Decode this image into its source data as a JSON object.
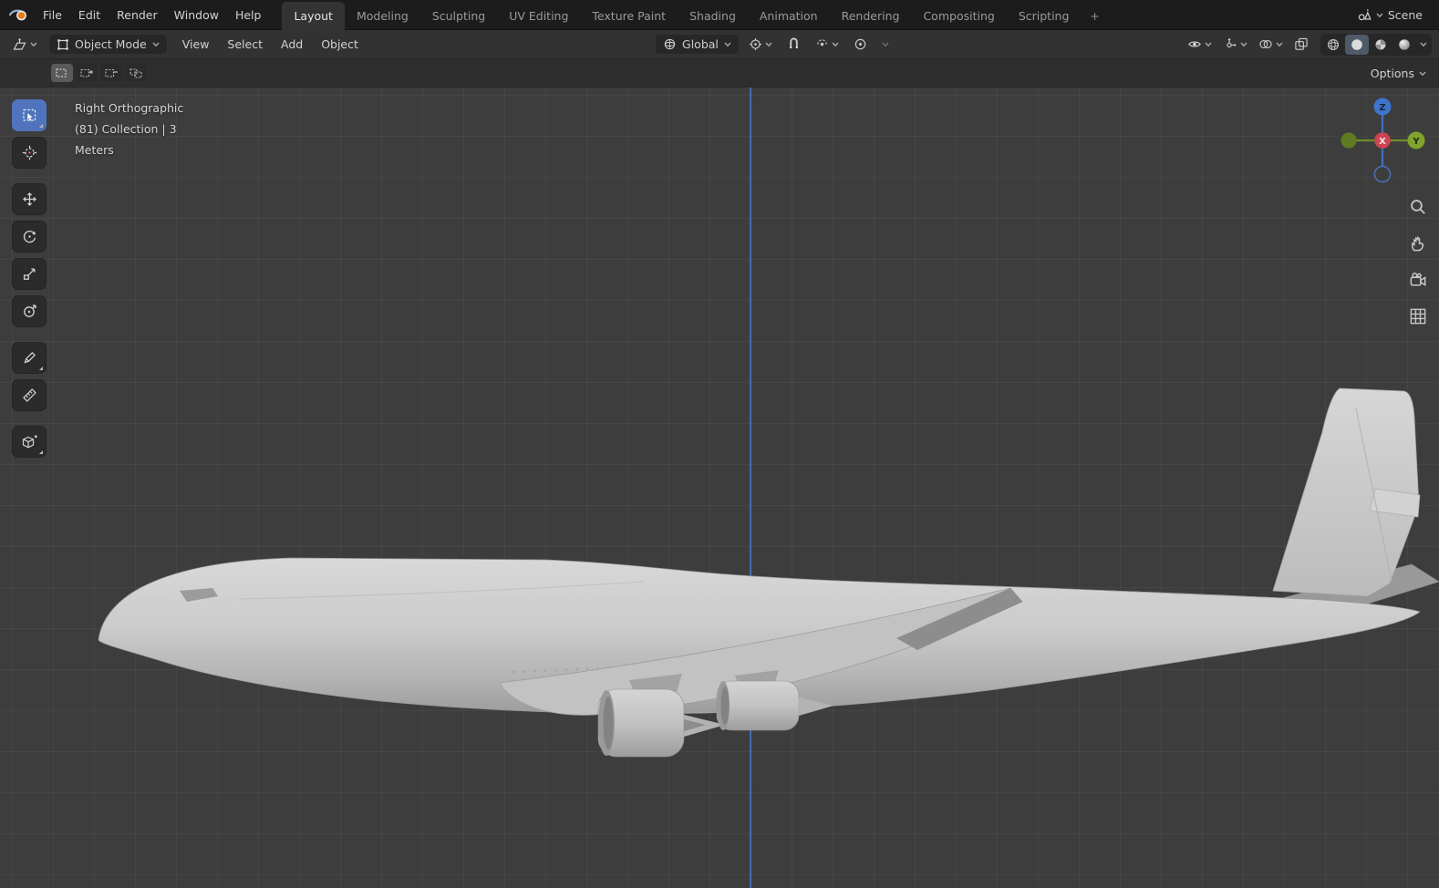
{
  "topbar": {
    "menus": [
      "File",
      "Edit",
      "Render",
      "Window",
      "Help"
    ],
    "tabs": [
      "Layout",
      "Modeling",
      "Sculpting",
      "UV Editing",
      "Texture Paint",
      "Shading",
      "Animation",
      "Rendering",
      "Compositing",
      "Scripting"
    ],
    "add_tab_label": "+",
    "scene_label": "Scene"
  },
  "viewport_header": {
    "mode_label": "Object Mode",
    "menus": [
      "View",
      "Select",
      "Add",
      "Object"
    ],
    "orientation_label": "Global"
  },
  "tool_settings": {
    "options_label": "Options"
  },
  "viewport_overlay": {
    "view_label": "Right Orthographic",
    "collection_label": "(81) Collection | 3",
    "units_label": "Meters"
  },
  "axis_gizmo": {
    "x_label": "X",
    "y_label": "Y",
    "z_label": "Z"
  },
  "left_toolbar_tools": [
    "select-box",
    "cursor",
    "move",
    "rotate",
    "scale",
    "transform",
    "annotate",
    "measure",
    "add-cube"
  ],
  "colors": {
    "accent_blue": "#4772b3",
    "axis_x_red": "#d04545",
    "axis_y_green": "#7fa32b",
    "axis_z_blue": "#3f74cc",
    "z_axis_line_blue": "#4a74c8",
    "viewport_bg": "#3d3d3d",
    "model_gray": "#c6c6c6"
  }
}
